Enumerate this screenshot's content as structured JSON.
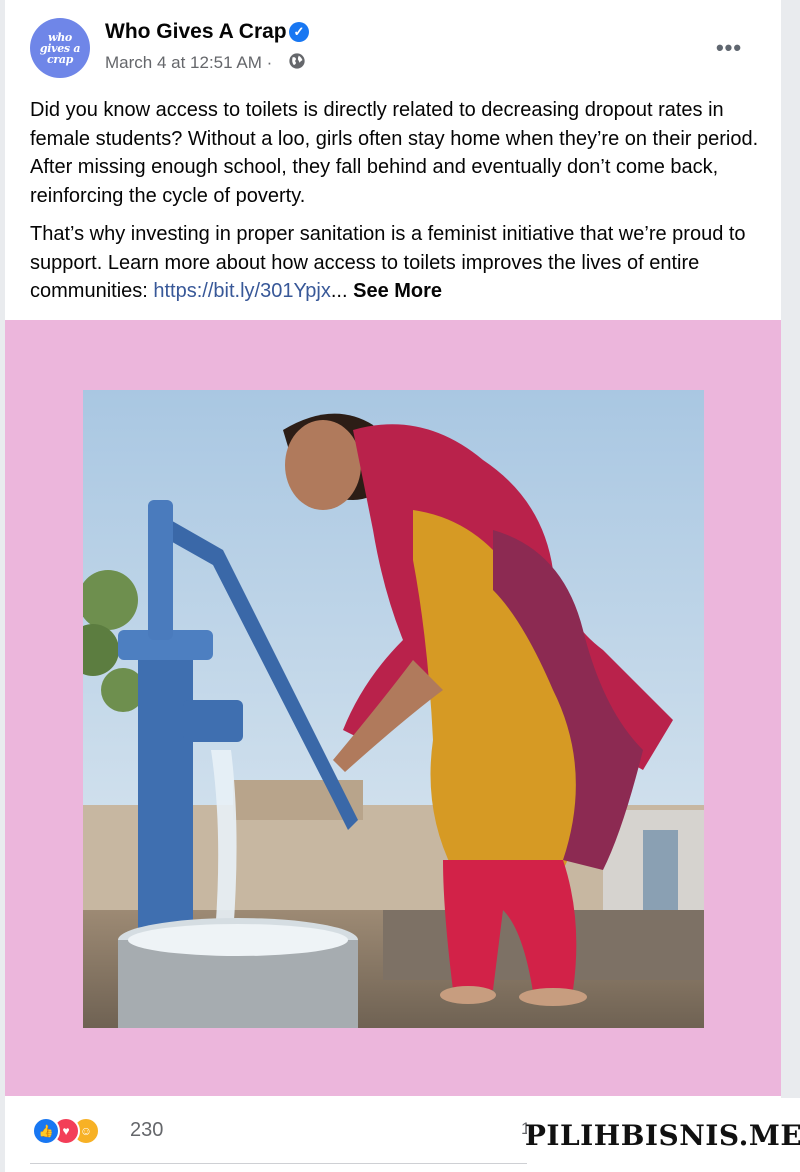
{
  "post": {
    "page_name": "Who Gives A Crap",
    "avatar_text": [
      "who",
      "gives a",
      "crap"
    ],
    "timestamp": "March 4 at 12:51 AM ·",
    "paragraph1": "Did you know access to toilets is directly related to decreasing dropout rates in female students? Without a loo, girls often stay home when they’re on their period. After missing enough school, they fall behind and eventually don’t come back, reinforcing the cycle of poverty.",
    "paragraph2_text": "That’s why investing in proper sanitation is a feminist initiative that we’re proud to support. Learn more about how access to toilets improves the lives of entire communities: ",
    "link": "https://bit.ly/301Ypjx",
    "ellipsis": "...",
    "see_more": "See More",
    "more_button": "•••",
    "icons": {
      "verified": "verified-badge-icon",
      "privacy": "globe-icon",
      "more": "more-options-icon"
    }
  },
  "media": {
    "background": "#ecb6dc",
    "image_description_icon": "photo"
  },
  "footer": {
    "reactions": [
      "like",
      "love",
      "care"
    ],
    "reaction_count": "230",
    "comment_count": "1"
  },
  "watermark": {
    "text": "PILIHBISNIS.ME"
  },
  "colors": {
    "accent": "#1877f2",
    "link": "#385898",
    "secondary_text": "#65676b",
    "avatar": "#6f86e8"
  }
}
